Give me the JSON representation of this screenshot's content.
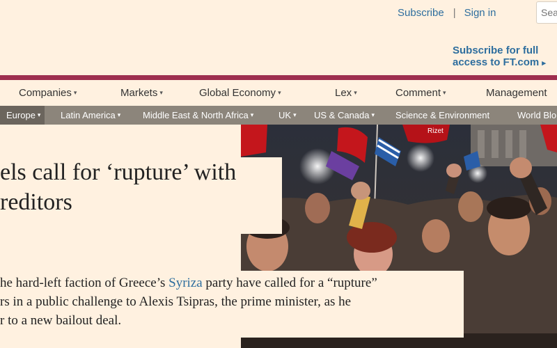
{
  "header": {
    "subscribe_link": "Subscribe",
    "separator": "|",
    "signin_link": "Sign in",
    "search_placeholder": "Sea",
    "promo_line1": "Subscribe for full",
    "promo_line2": "access to FT.com",
    "promo_arrow": "▸",
    "brand_color": "#9e2f50",
    "link_color": "#2e6e9e"
  },
  "nav_primary": [
    {
      "label": "Companies"
    },
    {
      "label": "Markets"
    },
    {
      "label": "Global Economy"
    },
    {
      "label": "Lex"
    },
    {
      "label": "Comment"
    },
    {
      "label": "Management"
    }
  ],
  "nav_secondary": [
    {
      "label": "Europe",
      "active": true,
      "has_caret": true
    },
    {
      "label": "Latin America",
      "has_caret": true
    },
    {
      "label": "Middle East & North Africa",
      "has_caret": true
    },
    {
      "label": "UK",
      "has_caret": true
    },
    {
      "label": "US & Canada",
      "has_caret": true
    },
    {
      "label": "Science & Environment",
      "has_caret": false
    },
    {
      "label": "World Blo",
      "has_caret": false
    }
  ],
  "article": {
    "headline_line1": "els call for ‘rupture’ with",
    "headline_line2": "reditors",
    "standfirst_pre": "he hard-left faction of Greece’s ",
    "standfirst_link": "Syriza",
    "standfirst_post": " party have called for a “rupture”",
    "standfirst_line2": "rs in a public challenge to Alexis Tsipras, the prime minister, as he",
    "standfirst_line3": "r to a new bailout deal.",
    "photo_flag_text": "Rizet"
  }
}
